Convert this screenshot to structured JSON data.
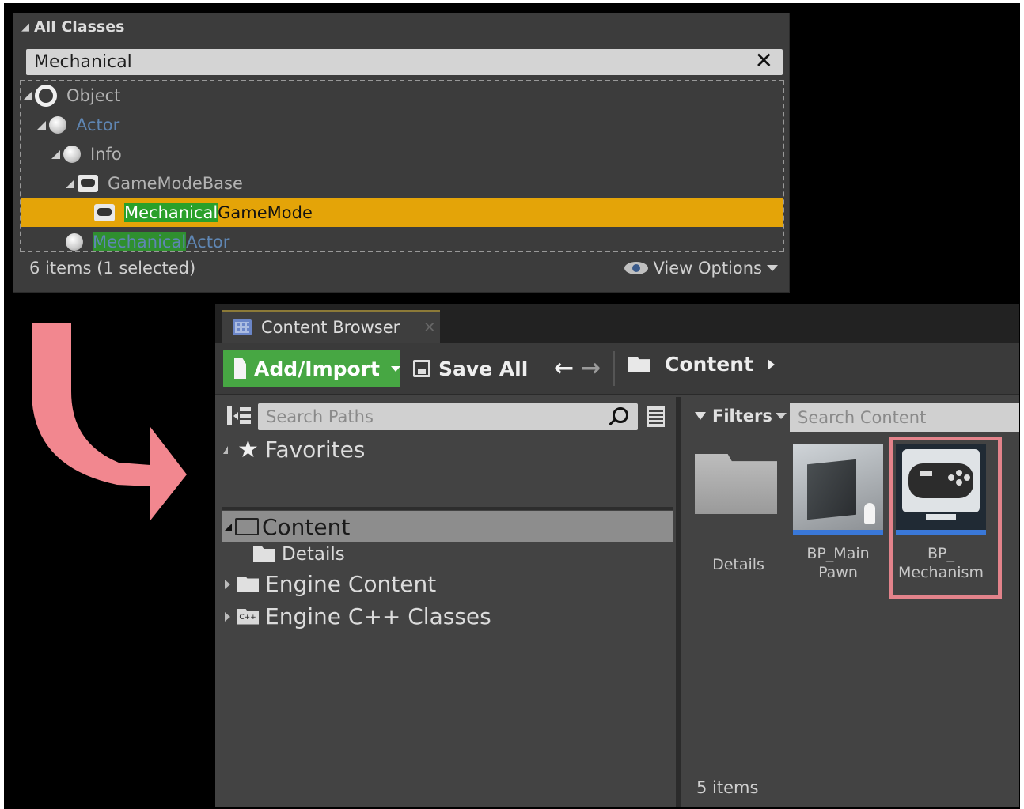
{
  "class_picker": {
    "header": "All Classes",
    "search_value": "Mechanical",
    "clear_glyph": "✕",
    "tree": [
      {
        "label": "Object"
      },
      {
        "label": "Actor"
      },
      {
        "label": "Info"
      },
      {
        "label": "GameModeBase"
      },
      {
        "match": "Mechanical",
        "rest": "GameMode",
        "selected": true
      },
      {
        "match": "Mechanical",
        "rest": "Actor"
      }
    ],
    "status": "6 items (1 selected)",
    "view_options": "View Options"
  },
  "content_browser": {
    "tab_label": "Content Browser",
    "tab_close": "✕",
    "toolbar": {
      "add_import": "Add/Import",
      "save_all": "Save All",
      "back_glyph": "🡐",
      "forward_glyph": "🡒",
      "breadcrumb": "Content"
    },
    "sources": {
      "search_placeholder": "Search Paths",
      "favorites": "Favorites",
      "tree": {
        "content": "Content",
        "details": "Details",
        "engine_content": "Engine Content",
        "engine_cpp": "Engine C++ Classes",
        "cpp_badge": "C++"
      }
    },
    "assets_panel": {
      "filters": "Filters",
      "search_placeholder": "Search Content",
      "assets": [
        {
          "line1": "Details",
          "line2": "",
          "icon": "folder-icon"
        },
        {
          "line1": "BP_Main",
          "line2": "Pawn",
          "icon": "pawn-thumbnail"
        },
        {
          "line1": "BP_",
          "line2": "Mechanism",
          "icon": "gamepad-monitor-icon",
          "highlighted": true
        }
      ],
      "item_count": "5 items"
    }
  },
  "colors": {
    "selection": "#e4a408",
    "match_highlight": "#2aa02a",
    "add_button": "#47a743",
    "callout": "#e3838b",
    "arrow": "#f2878f"
  }
}
